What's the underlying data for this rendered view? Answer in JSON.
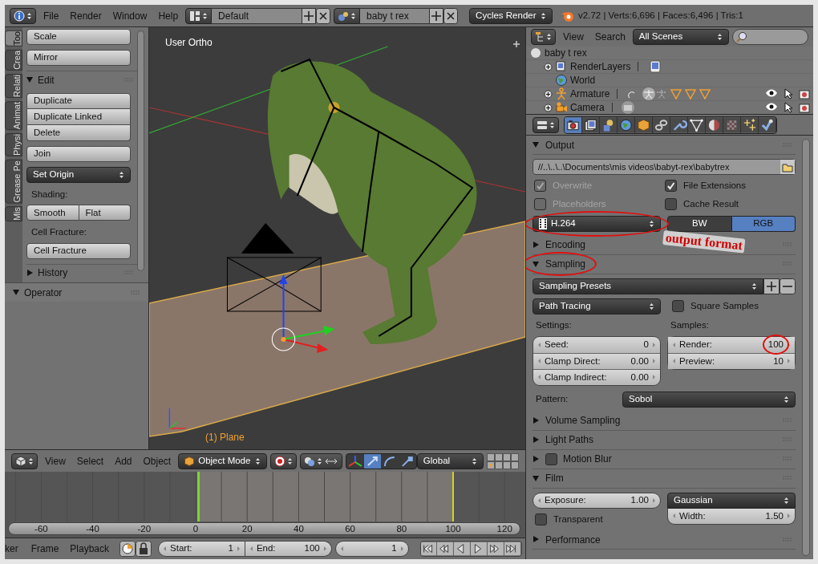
{
  "top_bar": {
    "menus": [
      "File",
      "Render",
      "Window",
      "Help"
    ],
    "screen_layout": "Default",
    "scene": "baby t rex",
    "render_engine": "Cycles Render",
    "stats": "v2.72 | Verts:6,696 | Faces:6,496 | Tris:1"
  },
  "tool_shelf": {
    "tabs": [
      {
        "label": "Too",
        "selected": true
      },
      {
        "label": "Crea",
        "selected": false
      },
      {
        "label": "Relati",
        "selected": false
      },
      {
        "label": "Animat",
        "selected": false
      },
      {
        "label": "Physi",
        "selected": false
      },
      {
        "label": "Grease Pe",
        "selected": false
      },
      {
        "label": "Mis",
        "selected": false
      }
    ],
    "items": [
      {
        "kind": "button",
        "label": "Scale"
      },
      {
        "kind": "button",
        "label": "Mirror"
      },
      {
        "kind": "panel",
        "label": "Edit",
        "expanded": true
      },
      {
        "kind": "button_group",
        "labels": [
          "Duplicate",
          "Duplicate Linked",
          "Delete"
        ]
      },
      {
        "kind": "button",
        "label": "Join"
      },
      {
        "kind": "dropdown",
        "label": "Set Origin"
      },
      {
        "kind": "label",
        "label": "Shading:"
      },
      {
        "kind": "button_row",
        "labels": [
          "Smooth",
          "Flat"
        ]
      },
      {
        "kind": "label",
        "label": "Cell Fracture:"
      },
      {
        "kind": "button",
        "label": "Cell Fracture"
      },
      {
        "kind": "panel",
        "label": "History",
        "expanded": false
      }
    ],
    "operator_panel": {
      "label": "Operator",
      "expanded": true
    }
  },
  "viewport": {
    "view_name": "User Ortho",
    "active_object": "(1) Plane"
  },
  "viewport_header": {
    "menus": [
      "View",
      "Select",
      "Add",
      "Object"
    ],
    "mode": "Object Mode",
    "orientation": "Global"
  },
  "timeline": {
    "ruler": [
      "-60",
      "-40",
      "-20",
      "0",
      "20",
      "40",
      "60",
      "80",
      "100",
      "120"
    ]
  },
  "timeline_header": {
    "menus": [
      "ker",
      "Frame",
      "Playback"
    ],
    "start": {
      "label": "Start:",
      "value": "1"
    },
    "end": {
      "label": "End:",
      "value": "100"
    },
    "current_frame": "1"
  },
  "outliner": {
    "menus": [
      "View",
      "Search"
    ],
    "filter": "All Scenes",
    "tree": [
      {
        "kind": "scene",
        "label": "baby t rex",
        "children": [
          {
            "kind": "render_layers",
            "label": "RenderLayers",
            "collapsed": true
          },
          {
            "kind": "world",
            "label": "World",
            "collapsed": false
          },
          {
            "kind": "armature",
            "label": "Armature",
            "collapsed": true
          },
          {
            "kind": "camera",
            "label": "Camera",
            "collapsed": true
          }
        ]
      }
    ]
  },
  "properties": {
    "tabs": [
      {
        "selected": true
      },
      {
        "selected": false
      },
      {
        "selected": false
      },
      {
        "selected": false
      },
      {
        "selected": false
      },
      {
        "selected": false
      },
      {
        "selected": false
      },
      {
        "selected": false
      },
      {
        "selected": false
      },
      {
        "selected": false
      },
      {
        "selected": false
      },
      {
        "selected": false
      }
    ],
    "panels": [
      {
        "kind": "output",
        "label": "Output",
        "expanded": true,
        "path": "//..\\..\\..\\Documents\\mis videos\\babyt-rex\\babytrex",
        "checkboxes": [
          {
            "label": "Overwrite",
            "checked": true,
            "disabled": true
          },
          {
            "label": "File Extensions",
            "checked": true,
            "disabled": false
          },
          {
            "label": "Placeholders",
            "checked": false,
            "disabled": true
          },
          {
            "label": "Cache Result",
            "checked": false,
            "disabled": false
          }
        ],
        "format": "H.264",
        "color_modes": [
          {
            "label": "BW",
            "selected": false
          },
          {
            "label": "RGB",
            "selected": true
          }
        ]
      },
      {
        "kind": "collapsed",
        "label": "Encoding",
        "expanded": false
      },
      {
        "kind": "sampling",
        "label": "Sampling",
        "expanded": true,
        "presets": "Sampling Presets",
        "integrator": "Path Tracing",
        "square_samples": {
          "label": "Square Samples",
          "checked": false
        },
        "settings_label": "Settings:",
        "settings": [
          {
            "label": "Seed:",
            "value": "0"
          },
          {
            "label": "Clamp Direct:",
            "value": "0.00"
          },
          {
            "label": "Clamp Indirect:",
            "value": "0.00"
          }
        ],
        "samples_label": "Samples:",
        "samples": [
          {
            "label": "Render:",
            "value": "100"
          },
          {
            "label": "Preview:",
            "value": "10"
          }
        ],
        "pattern_label": "Pattern:",
        "pattern": "Sobol"
      },
      {
        "kind": "collapsed",
        "label": "Volume Sampling",
        "expanded": false
      },
      {
        "kind": "collapsed",
        "label": "Light Paths",
        "expanded": false
      },
      {
        "kind": "collapsed",
        "label": "Motion Blur",
        "expanded": false,
        "enabled": false
      },
      {
        "kind": "film",
        "label": "Film",
        "expanded": true,
        "exposure": {
          "label": "Exposure:",
          "value": "1.00"
        },
        "filter": "Gaussian",
        "width": {
          "label": "Width:",
          "value": "1.50"
        },
        "transparent": {
          "label": "Transparent",
          "checked": false
        }
      },
      {
        "kind": "collapsed",
        "label": "Performance",
        "expanded": false
      }
    ]
  },
  "annotation": {
    "text": "output format"
  }
}
